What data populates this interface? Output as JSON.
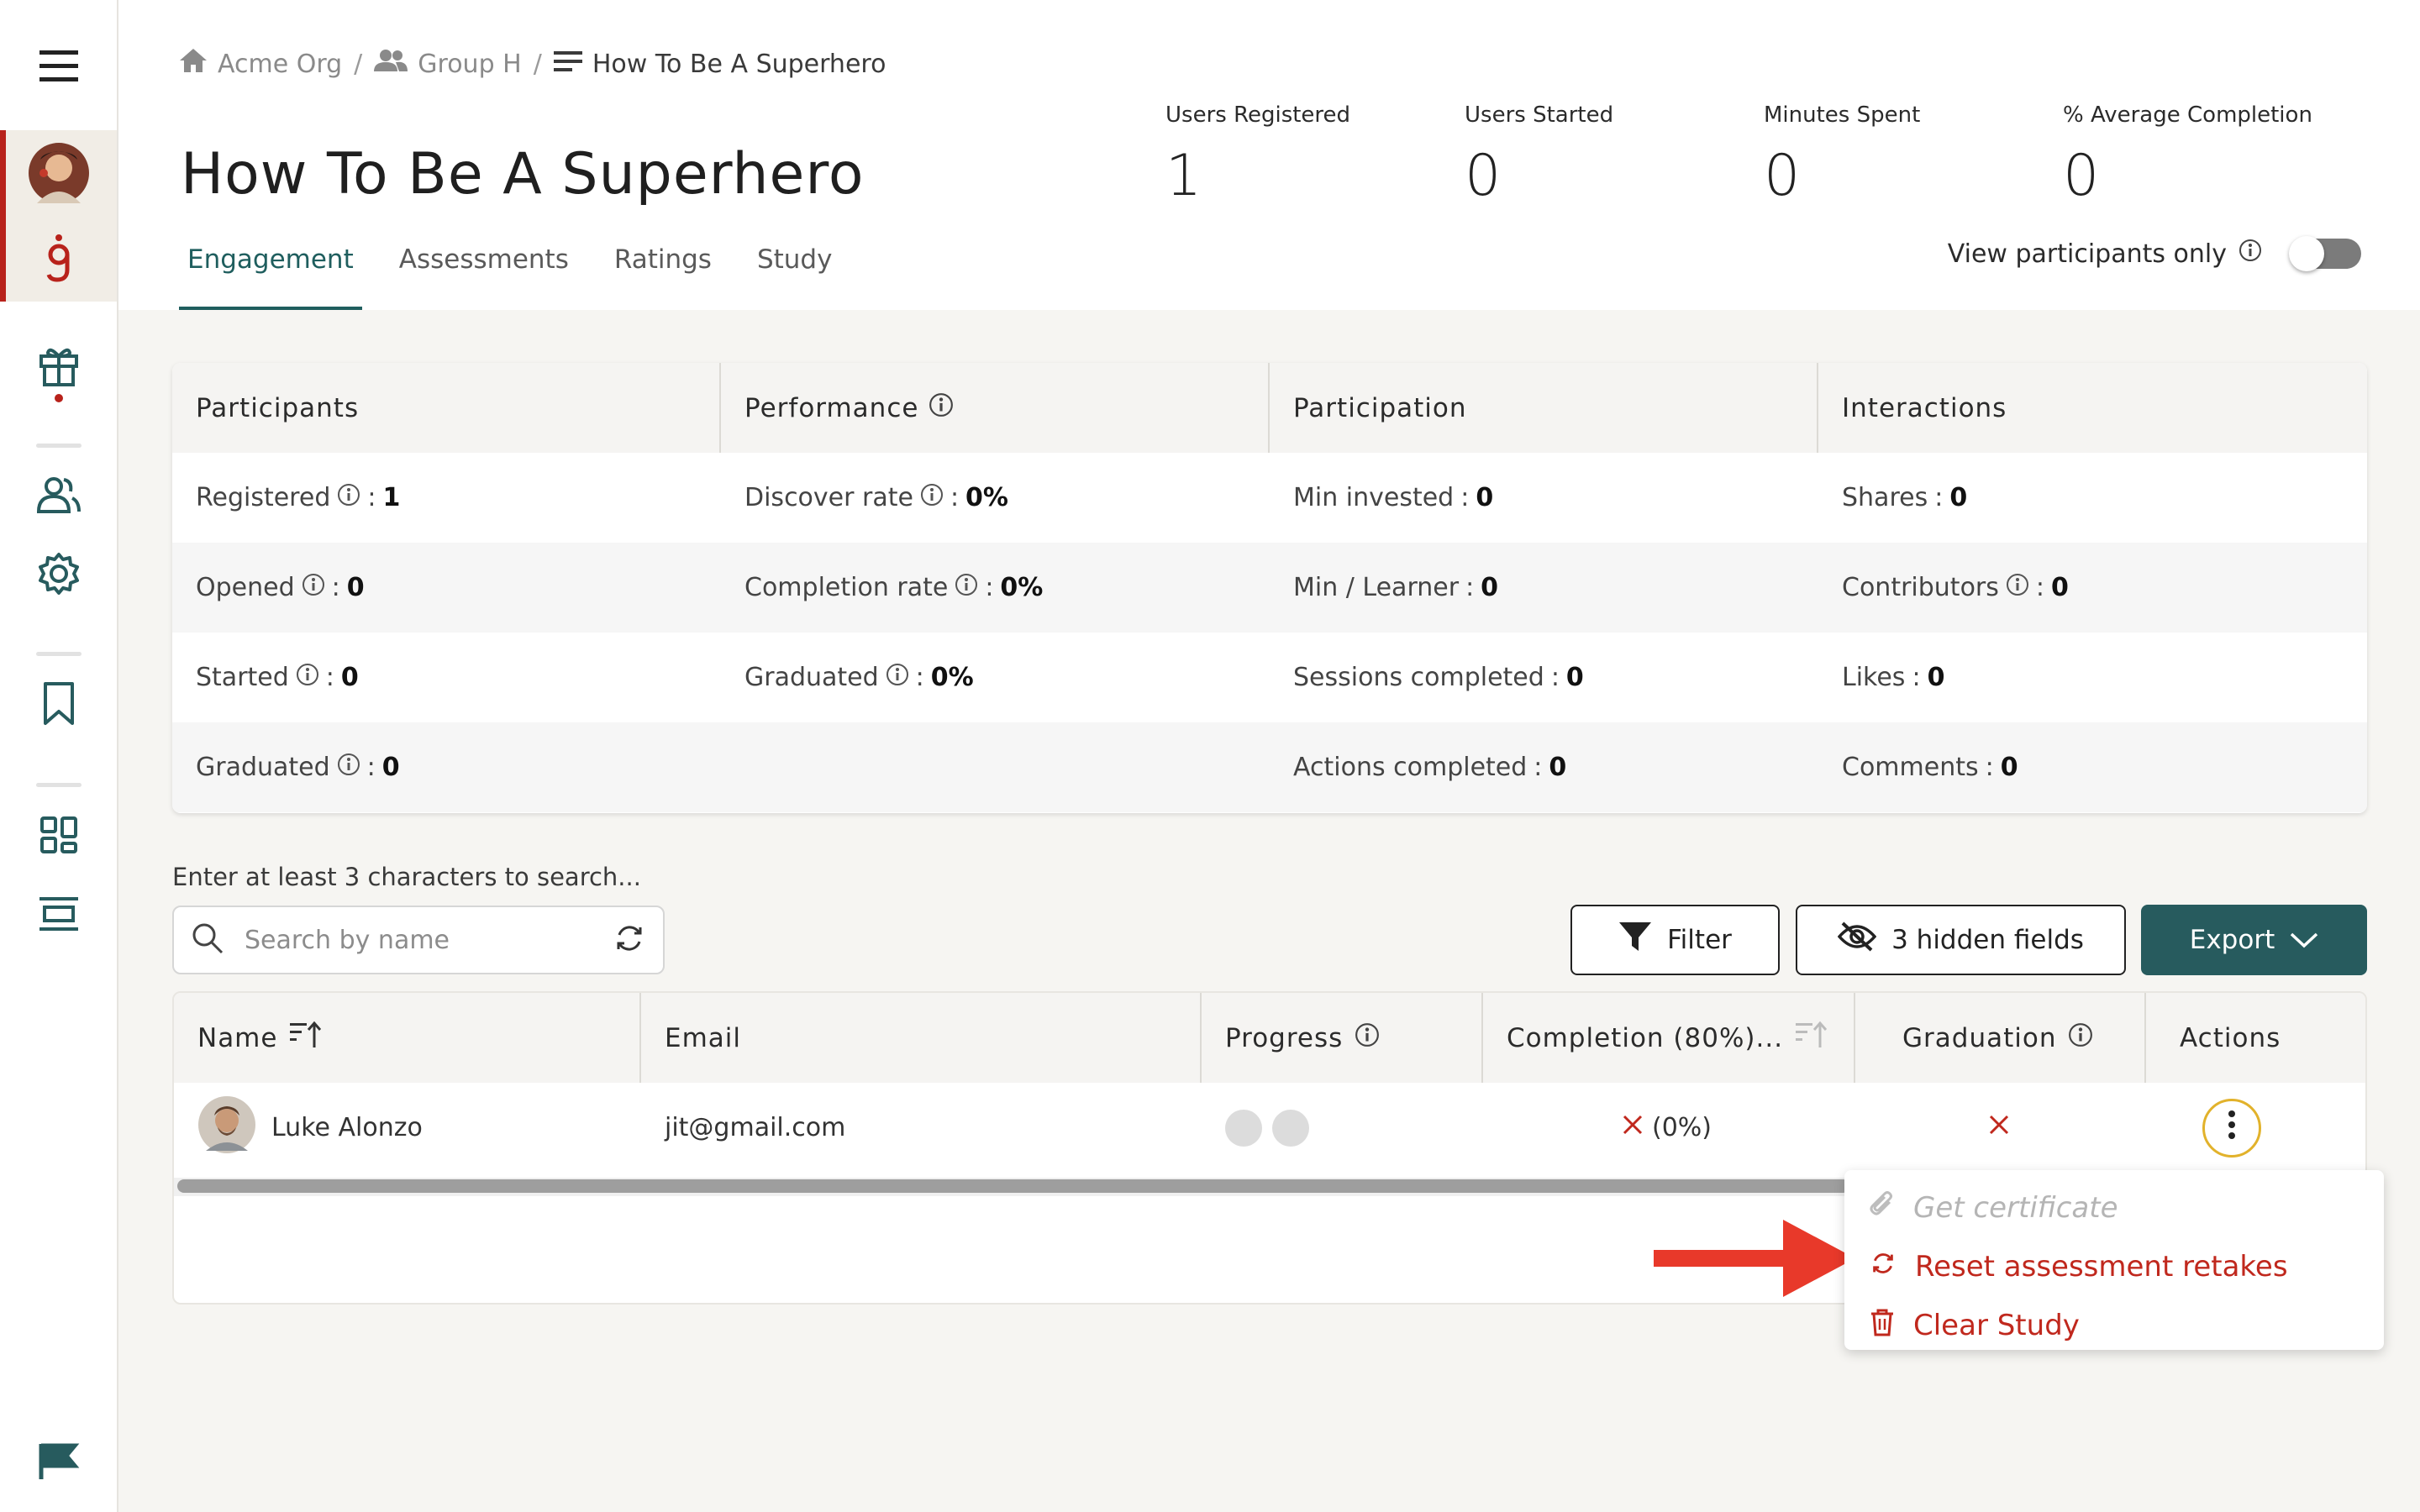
{
  "colors": {
    "accent": "#275b5e",
    "brand_red": "#b8221b",
    "danger": "#c0281d",
    "focus_ring": "#e2b22b",
    "arrow": "#e8392a"
  },
  "rail": {
    "icons": [
      "menu-icon",
      "avatar",
      "brand-g-icon",
      "gift-icon",
      "users-icon",
      "settings-icon",
      "bookmark-icon",
      "dashboard-icon",
      "layout-icon",
      "flag-icon"
    ]
  },
  "breadcrumb": {
    "items": [
      {
        "label": "Acme Org",
        "icon": "home-icon"
      },
      {
        "label": "Group H",
        "icon": "group-icon"
      },
      {
        "label": "How To Be A Superhero",
        "icon": "list-icon"
      }
    ],
    "separator": "/"
  },
  "page_title": "How To Be A Superhero",
  "stats": [
    {
      "label": "Users Registered",
      "value": "1"
    },
    {
      "label": "Users Started",
      "value": "0"
    },
    {
      "label": "Minutes Spent",
      "value": "0"
    },
    {
      "label": "% Average Completion",
      "value": "0"
    }
  ],
  "tabs": [
    {
      "label": "Engagement",
      "active": true
    },
    {
      "label": "Assessments",
      "active": false
    },
    {
      "label": "Ratings",
      "active": false
    },
    {
      "label": "Study",
      "active": false
    }
  ],
  "view_participants": {
    "label": "View participants only",
    "enabled": false
  },
  "summary": {
    "columns": [
      {
        "title": "Participants",
        "info": false,
        "rows": [
          {
            "label": "Registered",
            "info": true,
            "value": "1"
          },
          {
            "label": "Opened",
            "info": true,
            "value": "0"
          },
          {
            "label": "Started",
            "info": true,
            "value": "0"
          },
          {
            "label": "Graduated",
            "info": true,
            "value": "0"
          }
        ]
      },
      {
        "title": "Performance",
        "info": true,
        "rows": [
          {
            "label": "Discover rate",
            "info": true,
            "value": "0%"
          },
          {
            "label": "Completion rate",
            "info": true,
            "value": "0%"
          },
          {
            "label": "Graduated",
            "info": true,
            "value": "0%"
          }
        ]
      },
      {
        "title": "Participation",
        "info": false,
        "rows": [
          {
            "label": "Min invested",
            "info": false,
            "value": "0"
          },
          {
            "label": "Min / Learner",
            "info": false,
            "value": "0"
          },
          {
            "label": "Sessions completed",
            "info": false,
            "value": "0"
          },
          {
            "label": "Actions completed",
            "info": false,
            "value": "0"
          }
        ]
      },
      {
        "title": "Interactions",
        "info": false,
        "rows": [
          {
            "label": "Shares",
            "info": false,
            "value": "0"
          },
          {
            "label": "Contributors",
            "info": true,
            "value": "0"
          },
          {
            "label": "Likes",
            "info": false,
            "value": "0"
          },
          {
            "label": "Comments",
            "info": false,
            "value": "0"
          }
        ]
      }
    ]
  },
  "search": {
    "hint": "Enter at least 3 characters to search...",
    "placeholder": "Search by name",
    "value": ""
  },
  "toolbar": {
    "filter_label": "Filter",
    "hidden_fields_label": "3 hidden fields",
    "export_label": "Export"
  },
  "table": {
    "headers": {
      "name": "Name",
      "email": "Email",
      "progress": "Progress",
      "completion": "Completion (80%)...",
      "graduation": "Graduation",
      "actions": "Actions"
    },
    "rows": [
      {
        "name": "Luke Alonzo",
        "email": "jit@gmail.com",
        "progress_steps_done": 0,
        "progress_steps_total": 2,
        "completion": "(0%)",
        "completed": false,
        "graduated": false
      }
    ]
  },
  "actions_menu": {
    "items": [
      {
        "label": "Get certificate",
        "icon": "paperclip-icon",
        "disabled": true
      },
      {
        "label": "Reset assessment retakes",
        "icon": "refresh-icon",
        "disabled": false
      },
      {
        "label": "Clear Study",
        "icon": "trash-icon",
        "disabled": false
      }
    ]
  }
}
